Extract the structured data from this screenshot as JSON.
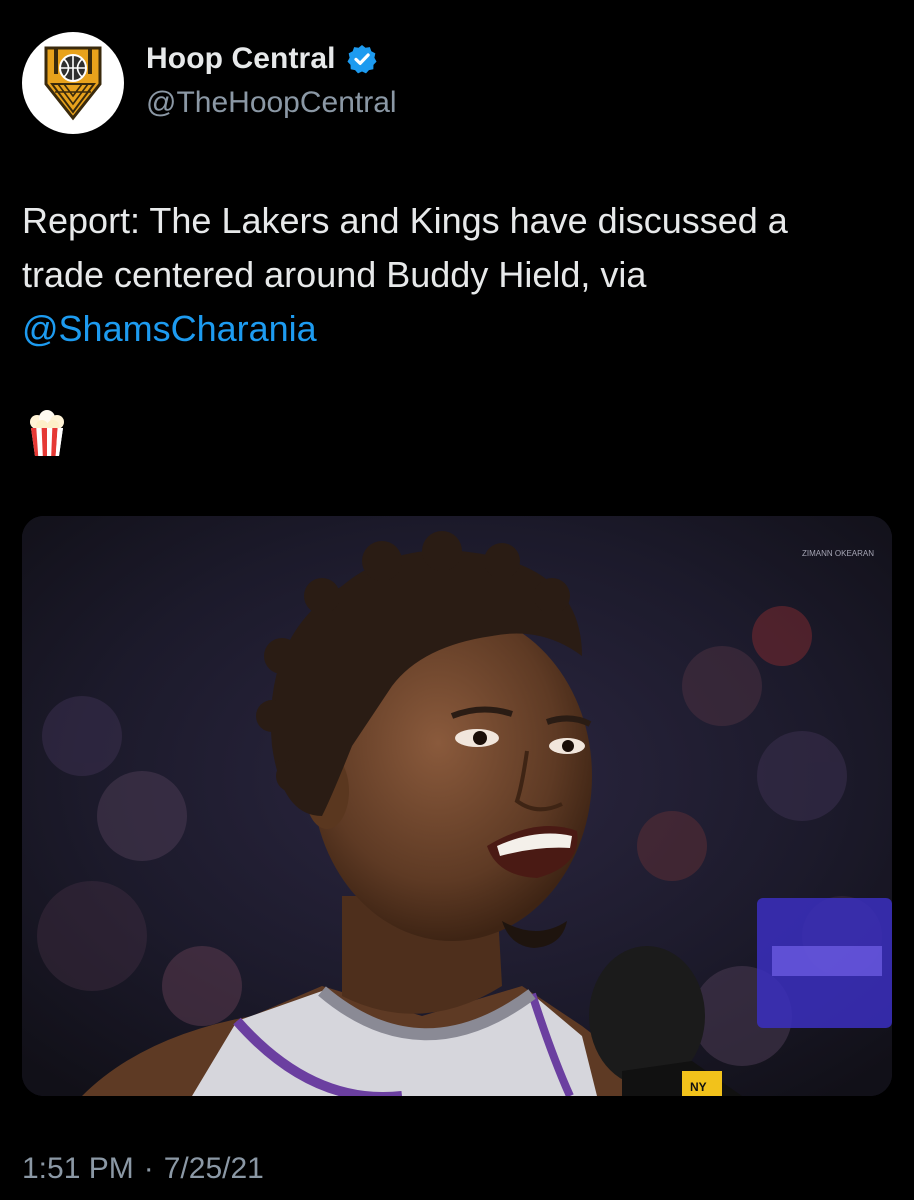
{
  "author": {
    "display_name": "Hoop Central",
    "handle": "@TheHoopCentral",
    "avatar_icon": "hoop-central-logo-icon",
    "verified_icon": "verified-badge-icon",
    "verified_color": "#1d9bf0"
  },
  "tweet": {
    "text_lines": [
      "Report: The Lakers and Kings have discussed a",
      "trade centered around Buddy Hield, via"
    ],
    "mention": "@ShamsCharania",
    "emoji_icon": "popcorn-icon"
  },
  "media": {
    "image_icon": "player-photo-image",
    "watermark_line": "ZIMANN OKEARAN",
    "mic_label": "NY"
  },
  "meta": {
    "time": "1:51 PM",
    "separator": "·",
    "date": "7/25/21"
  },
  "colors": {
    "background": "#000000",
    "text": "#e7e9ea",
    "secondary": "#8b98a5",
    "accent": "#1d9bf0"
  }
}
